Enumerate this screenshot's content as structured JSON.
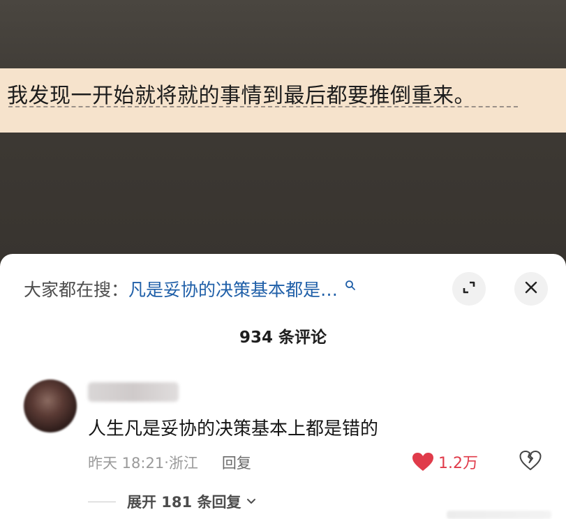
{
  "subtitle": {
    "text": "我发现一开始就将就的事情到最后都要推倒重来。"
  },
  "search": {
    "prefix": "大家都在搜：",
    "query": "凡是妥协的决策基本都是…",
    "search_icon": "search-icon"
  },
  "controls": {
    "expand_icon": "expand-icon",
    "close_icon": "close-icon"
  },
  "comments": {
    "count_label": "934 条评论",
    "items": [
      {
        "text": "人生凡是妥协的决策基本上都是错的",
        "time": "昨天 18:21",
        "separator": "·",
        "location": "浙江",
        "reply_label": "回复",
        "likes": "1.2万",
        "like_icon": "heart-icon",
        "dislike_icon": "broken-heart-icon",
        "expand_label": "展开 181 条回复"
      }
    ]
  },
  "colors": {
    "accent_link": "#1f5fa8",
    "like_red": "#e03b4a",
    "subtitle_band": "#f6e3cc"
  }
}
